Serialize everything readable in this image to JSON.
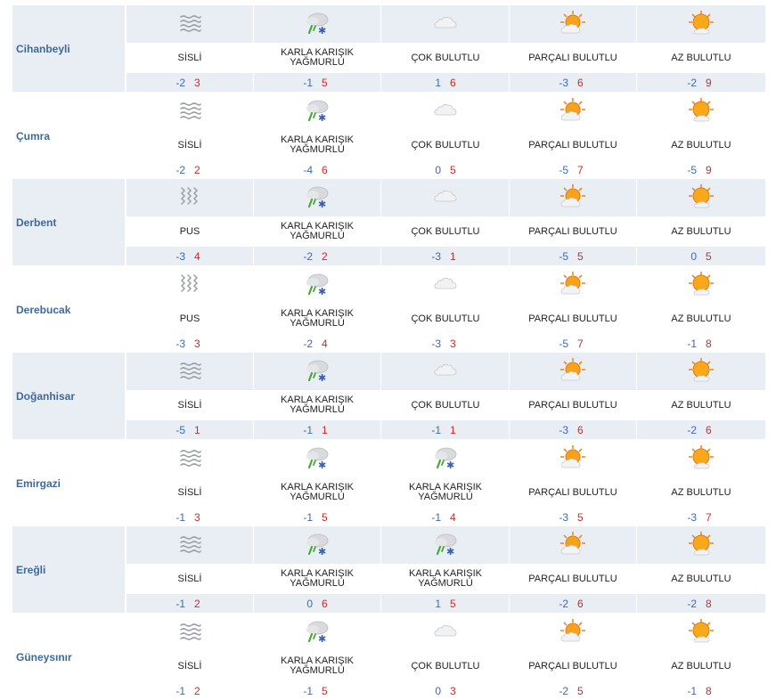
{
  "days_count": 5,
  "rows": [
    {
      "city": "Cihanbeyli",
      "shaded": true,
      "days": [
        {
          "icon": "fog-icon",
          "label1": "SİSLİ",
          "label2": "",
          "min": "-2",
          "max": "3"
        },
        {
          "icon": "sleet-icon",
          "label1": "KARLA KARIŞIK",
          "label2": "YAĞMURLU",
          "min": "-1",
          "max": "5"
        },
        {
          "icon": "cloudy-icon",
          "label1": "ÇOK BULUTLU",
          "label2": "",
          "min": "1",
          "max": "6"
        },
        {
          "icon": "partly-cloudy-icon",
          "label1": "PARÇALI BULUTLU",
          "label2": "",
          "min": "-3",
          "max": "6"
        },
        {
          "icon": "mostly-sunny-icon",
          "label1": "AZ BULUTLU",
          "label2": "",
          "min": "-2",
          "max": "9"
        }
      ]
    },
    {
      "city": "Çumra",
      "shaded": false,
      "days": [
        {
          "icon": "fog-icon",
          "label1": "SİSLİ",
          "label2": "",
          "min": "-2",
          "max": "2"
        },
        {
          "icon": "sleet-icon",
          "label1": "KARLA KARIŞIK",
          "label2": "YAĞMURLU",
          "min": "-4",
          "max": "6"
        },
        {
          "icon": "cloudy-icon",
          "label1": "ÇOK BULUTLU",
          "label2": "",
          "min": "0",
          "max": "5"
        },
        {
          "icon": "partly-cloudy-icon",
          "label1": "PARÇALI BULUTLU",
          "label2": "",
          "min": "-5",
          "max": "7"
        },
        {
          "icon": "mostly-sunny-icon",
          "label1": "AZ BULUTLU",
          "label2": "",
          "min": "-5",
          "max": "9"
        }
      ]
    },
    {
      "city": "Derbent",
      "shaded": true,
      "days": [
        {
          "icon": "mist-icon",
          "label1": "PUS",
          "label2": "",
          "min": "-3",
          "max": "4"
        },
        {
          "icon": "sleet-icon",
          "label1": "KARLA KARIŞIK",
          "label2": "YAĞMURLU",
          "min": "-2",
          "max": "2"
        },
        {
          "icon": "cloudy-icon",
          "label1": "ÇOK BULUTLU",
          "label2": "",
          "min": "-3",
          "max": "1"
        },
        {
          "icon": "partly-cloudy-icon",
          "label1": "PARÇALI BULUTLU",
          "label2": "",
          "min": "-5",
          "max": "5"
        },
        {
          "icon": "mostly-sunny-icon",
          "label1": "AZ BULUTLU",
          "label2": "",
          "min": "0",
          "max": "5"
        }
      ]
    },
    {
      "city": "Derebucak",
      "shaded": false,
      "days": [
        {
          "icon": "mist-icon",
          "label1": "PUS",
          "label2": "",
          "min": "-3",
          "max": "3"
        },
        {
          "icon": "sleet-icon",
          "label1": "KARLA KARIŞIK",
          "label2": "YAĞMURLU",
          "min": "-2",
          "max": "4"
        },
        {
          "icon": "cloudy-icon",
          "label1": "ÇOK BULUTLU",
          "label2": "",
          "min": "-3",
          "max": "3"
        },
        {
          "icon": "partly-cloudy-icon",
          "label1": "PARÇALI BULUTLU",
          "label2": "",
          "min": "-5",
          "max": "7"
        },
        {
          "icon": "mostly-sunny-icon",
          "label1": "AZ BULUTLU",
          "label2": "",
          "min": "-1",
          "max": "8"
        }
      ]
    },
    {
      "city": "Doğanhisar",
      "shaded": true,
      "days": [
        {
          "icon": "fog-icon",
          "label1": "SİSLİ",
          "label2": "",
          "min": "-5",
          "max": "1"
        },
        {
          "icon": "sleet-icon",
          "label1": "KARLA KARIŞIK",
          "label2": "YAĞMURLU",
          "min": "-1",
          "max": "1"
        },
        {
          "icon": "cloudy-icon",
          "label1": "ÇOK BULUTLU",
          "label2": "",
          "min": "-1",
          "max": "1"
        },
        {
          "icon": "partly-cloudy-icon",
          "label1": "PARÇALI BULUTLU",
          "label2": "",
          "min": "-3",
          "max": "6"
        },
        {
          "icon": "mostly-sunny-icon",
          "label1": "AZ BULUTLU",
          "label2": "",
          "min": "-2",
          "max": "6"
        }
      ]
    },
    {
      "city": "Emirgazi",
      "shaded": false,
      "days": [
        {
          "icon": "fog-icon",
          "label1": "SİSLİ",
          "label2": "",
          "min": "-1",
          "max": "3"
        },
        {
          "icon": "sleet-icon",
          "label1": "KARLA KARIŞIK",
          "label2": "YAĞMURLU",
          "min": "-1",
          "max": "5"
        },
        {
          "icon": "sleet-icon",
          "label1": "KARLA KARIŞIK",
          "label2": "YAĞMURLU",
          "min": "-1",
          "max": "4"
        },
        {
          "icon": "partly-cloudy-icon",
          "label1": "PARÇALI BULUTLU",
          "label2": "",
          "min": "-3",
          "max": "5"
        },
        {
          "icon": "mostly-sunny-icon",
          "label1": "AZ BULUTLU",
          "label2": "",
          "min": "-3",
          "max": "7"
        }
      ]
    },
    {
      "city": "Ereğli",
      "shaded": true,
      "days": [
        {
          "icon": "fog-icon",
          "label1": "SİSLİ",
          "label2": "",
          "min": "-1",
          "max": "2"
        },
        {
          "icon": "sleet-icon",
          "label1": "KARLA KARIŞIK",
          "label2": "YAĞMURLU",
          "min": "0",
          "max": "6"
        },
        {
          "icon": "sleet-icon",
          "label1": "KARLA KARIŞIK",
          "label2": "YAĞMURLU",
          "min": "1",
          "max": "5"
        },
        {
          "icon": "partly-cloudy-icon",
          "label1": "PARÇALI BULUTLU",
          "label2": "",
          "min": "-2",
          "max": "6"
        },
        {
          "icon": "mostly-sunny-icon",
          "label1": "AZ BULUTLU",
          "label2": "",
          "min": "-2",
          "max": "8"
        }
      ]
    },
    {
      "city": "Güneysınır",
      "shaded": false,
      "days": [
        {
          "icon": "fog-icon",
          "label1": "SİSLİ",
          "label2": "",
          "min": "-1",
          "max": "2"
        },
        {
          "icon": "sleet-icon",
          "label1": "KARLA KARIŞIK",
          "label2": "YAĞMURLU",
          "min": "-1",
          "max": "5"
        },
        {
          "icon": "cloudy-icon",
          "label1": "ÇOK BULUTLU",
          "label2": "",
          "min": "0",
          "max": "3"
        },
        {
          "icon": "partly-cloudy-icon",
          "label1": "PARÇALI BULUTLU",
          "label2": "",
          "min": "-2",
          "max": "5"
        },
        {
          "icon": "mostly-sunny-icon",
          "label1": "AZ BULUTLU",
          "label2": "",
          "min": "-1",
          "max": "8"
        }
      ]
    }
  ],
  "colors": {
    "row_shade": "#e9eef4",
    "city_text": "#3d6a9a",
    "min_temp": "#3d6ab0",
    "max_temp": "#cc2a2a"
  }
}
